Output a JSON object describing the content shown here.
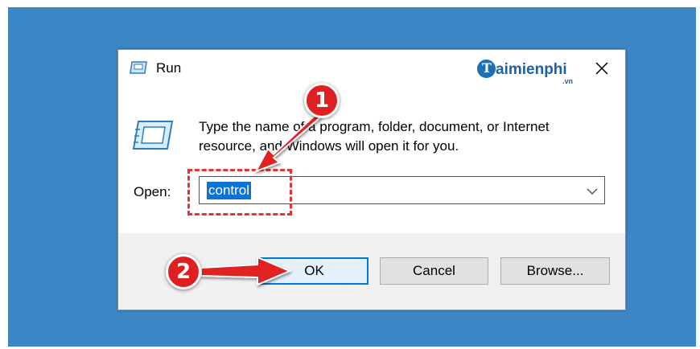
{
  "window": {
    "title": "Run",
    "logo_text": "aimienphi",
    "logo_letter": "T",
    "logo_suffix": ".vn"
  },
  "description": "Type the name of a program, folder, document, or Internet resource, and Windows will open it for you.",
  "open_label": "Open:",
  "open_value": "control",
  "buttons": {
    "ok": "OK",
    "cancel": "Cancel",
    "browse": "Browse..."
  },
  "annotations": {
    "step1": "1",
    "step2": "2"
  },
  "colors": {
    "desktop": "#3d86c6",
    "accent": "#0078d7",
    "annotation": "#e02020"
  }
}
